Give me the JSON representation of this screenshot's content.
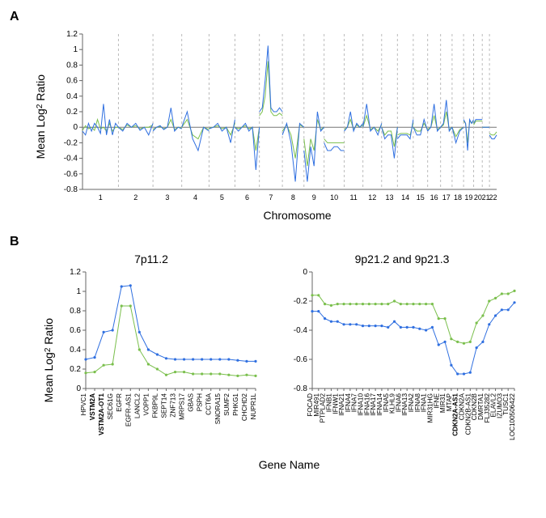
{
  "labels": {
    "panel_a": "A",
    "panel_b": "B",
    "ylabel_a": "Mean Log₂ Ratio",
    "xlabel_a": "Chromosome",
    "ylabel_b": "Mean Log₂ Ratio",
    "xlabel_b": "Gene Name",
    "title_b1": "7p11.2",
    "title_b2": "9p21.2 and 9p21.3"
  },
  "chart_data": [
    {
      "id": "panelA",
      "type": "line",
      "title": "",
      "xlabel": "Chromosome",
      "ylabel": "Mean Log2 Ratio",
      "ylim": [
        -0.8,
        1.2
      ],
      "yticks": [
        -0.8,
        -0.6,
        -0.4,
        -0.2,
        0,
        0.2,
        0.4,
        0.6,
        0.8,
        1,
        1.2
      ],
      "chrom_ticks": [
        1,
        2,
        3,
        4,
        5,
        6,
        7,
        8,
        9,
        10,
        11,
        12,
        13,
        14,
        15,
        16,
        17,
        18,
        19,
        20,
        21,
        22
      ],
      "series_blue_segments": [
        {
          "chrom": 1,
          "y": [
            -0.05,
            -0.1,
            0.05,
            -0.05,
            0.05,
            0.0,
            -0.08,
            0.3,
            -0.1,
            0.1,
            -0.1,
            0.05,
            0.0
          ]
        },
        {
          "chrom": 2,
          "y": [
            0.0,
            -0.05,
            0.05,
            0.0,
            0.05,
            -0.04,
            0.0,
            -0.1,
            0.05
          ]
        },
        {
          "chrom": 3,
          "y": [
            -0.05,
            0.0,
            0.02,
            -0.03,
            0.0,
            0.25,
            -0.05,
            0.0,
            -0.02
          ]
        },
        {
          "chrom": 4,
          "y": [
            0.0,
            0.2,
            -0.15,
            -0.3,
            0.0,
            -0.05
          ]
        },
        {
          "chrom": 5,
          "y": [
            -0.02,
            0.0,
            0.05,
            -0.05,
            0.0,
            -0.2,
            0.1
          ]
        },
        {
          "chrom": 6,
          "y": [
            0.0,
            -0.05,
            0.0,
            0.05,
            -0.05,
            0.0,
            -0.55,
            0.0
          ]
        },
        {
          "chrom": 7,
          "y": [
            0.2,
            0.25,
            0.6,
            1.05,
            0.25,
            0.2,
            0.2,
            0.25,
            0.2
          ]
        },
        {
          "chrom": 8,
          "y": [
            -0.1,
            0.05,
            -0.2,
            -0.7,
            0.05,
            0.0
          ]
        },
        {
          "chrom": 9,
          "y": [
            -0.3,
            -0.7,
            -0.25,
            -0.5,
            0.2,
            -0.05,
            0.0
          ]
        },
        {
          "chrom": 10,
          "y": [
            -0.2,
            -0.3,
            -0.3,
            -0.25,
            -0.25,
            -0.3,
            -0.3
          ]
        },
        {
          "chrom": 11,
          "y": [
            -0.05,
            0.0,
            0.2,
            -0.05,
            0.05,
            0.0,
            0.05
          ]
        },
        {
          "chrom": 12,
          "y": [
            0.0,
            0.3,
            -0.05,
            0.0,
            -0.1,
            0.05
          ]
        },
        {
          "chrom": 13,
          "y": [
            0.0,
            -0.15,
            -0.1,
            -0.1,
            -0.4,
            0.0
          ]
        },
        {
          "chrom": 14,
          "y": [
            -0.15,
            -0.1,
            -0.1,
            -0.1,
            -0.15,
            0.1
          ]
        },
        {
          "chrom": 15,
          "y": [
            0.0,
            -0.1,
            -0.1,
            0.1,
            -0.05
          ]
        },
        {
          "chrom": 16,
          "y": [
            -0.05,
            0.0,
            0.3,
            -0.05,
            0.0
          ]
        },
        {
          "chrom": 17,
          "y": [
            0.0,
            0.05,
            0.35,
            -0.05,
            0.0
          ]
        },
        {
          "chrom": 18,
          "y": [
            0.0,
            -0.2,
            -0.05,
            0.0
          ]
        },
        {
          "chrom": 19,
          "y": [
            0.1,
            0.05,
            -0.3,
            0.1,
            0.05,
            0.1
          ]
        },
        {
          "chrom": 20,
          "y": [
            0.05,
            0.1,
            0.1,
            0.1,
            0.1
          ]
        },
        {
          "chrom": 21,
          "y": [
            0.0,
            0.0,
            0.0
          ]
        },
        {
          "chrom": 22,
          "y": [
            -0.1,
            -0.15,
            -0.15,
            -0.1
          ]
        }
      ],
      "series_green_segments": [
        {
          "chrom": 1,
          "y": [
            -0.04,
            0.02,
            -0.02,
            0.0,
            -0.04,
            0.1,
            -0.02,
            0.0,
            -0.05,
            0.05,
            -0.05,
            0.0,
            0.0
          ]
        },
        {
          "chrom": 2,
          "y": [
            0.0,
            -0.03,
            0.03,
            0.0,
            0.02,
            -0.02,
            0.0,
            0.0,
            0.03
          ]
        },
        {
          "chrom": 3,
          "y": [
            -0.03,
            0.0,
            0.01,
            -0.02,
            0.0,
            0.1,
            -0.03,
            0.0,
            -0.01
          ]
        },
        {
          "chrom": 4,
          "y": [
            0.0,
            0.1,
            -0.1,
            -0.15,
            0.0,
            -0.03
          ]
        },
        {
          "chrom": 5,
          "y": [
            -0.01,
            0.0,
            0.02,
            -0.02,
            0.0,
            -0.1,
            0.05
          ]
        },
        {
          "chrom": 6,
          "y": [
            0.0,
            -0.02,
            0.0,
            0.02,
            -0.02,
            0.0,
            -0.3,
            0.0
          ]
        },
        {
          "chrom": 7,
          "y": [
            0.15,
            0.2,
            0.4,
            0.85,
            0.2,
            0.15,
            0.15,
            0.18,
            0.15
          ]
        },
        {
          "chrom": 8,
          "y": [
            -0.05,
            0.03,
            -0.1,
            -0.4,
            0.03,
            0.0
          ]
        },
        {
          "chrom": 9,
          "y": [
            -0.15,
            -0.5,
            -0.15,
            -0.3,
            0.1,
            -0.03,
            0.0
          ]
        },
        {
          "chrom": 10,
          "y": [
            -0.15,
            -0.2,
            -0.2,
            -0.2,
            -0.2,
            -0.2,
            -0.2
          ]
        },
        {
          "chrom": 11,
          "y": [
            -0.03,
            0.0,
            0.1,
            -0.03,
            0.03,
            0.0,
            0.03
          ]
        },
        {
          "chrom": 12,
          "y": [
            0.0,
            0.15,
            -0.03,
            0.0,
            -0.05,
            0.03
          ]
        },
        {
          "chrom": 13,
          "y": [
            0.0,
            -0.1,
            -0.05,
            -0.05,
            -0.25,
            0.0
          ]
        },
        {
          "chrom": 14,
          "y": [
            -0.1,
            -0.08,
            -0.08,
            -0.08,
            -0.1,
            0.05
          ]
        },
        {
          "chrom": 15,
          "y": [
            0.0,
            -0.05,
            -0.05,
            0.05,
            -0.03
          ]
        },
        {
          "chrom": 16,
          "y": [
            -0.03,
            0.0,
            0.15,
            -0.03,
            0.0
          ]
        },
        {
          "chrom": 17,
          "y": [
            0.0,
            0.03,
            0.2,
            -0.03,
            0.0
          ]
        },
        {
          "chrom": 18,
          "y": [
            0.0,
            -0.12,
            -0.03,
            0.0
          ]
        },
        {
          "chrom": 19,
          "y": [
            0.08,
            0.05,
            -0.2,
            0.08,
            0.05,
            0.08
          ]
        },
        {
          "chrom": 20,
          "y": [
            0.03,
            0.08,
            0.08,
            0.08,
            0.08
          ]
        },
        {
          "chrom": 21,
          "y": [
            0.0,
            0.0,
            0.0
          ]
        },
        {
          "chrom": 22,
          "y": [
            -0.08,
            -0.1,
            -0.1,
            -0.06
          ]
        }
      ]
    },
    {
      "id": "panelB1",
      "type": "line",
      "title": "7p11.2",
      "xlabel": "Gene Name",
      "ylabel": "Mean Log2 Ratio",
      "ylim": [
        0,
        1.2
      ],
      "yticks": [
        0,
        0.2,
        0.4,
        0.6,
        0.8,
        1,
        1.2
      ],
      "categories": [
        "HPVC1",
        "VSTM2A",
        "VSTM2A-OT1",
        "SEC61G",
        "EGFR",
        "EGFR-AS1",
        "LANCL2",
        "VOPP1",
        "FKBP9L",
        "SEPT14",
        "ZNF713",
        "MRPS17",
        "GBAS",
        "PSPH",
        "CCT6A",
        "SNORA15",
        "SUMF2",
        "PHKG1",
        "CHCHD2",
        "NUPR1L"
      ],
      "bold": [
        "VSTM2A",
        "VSTM2A-OT1"
      ],
      "series": [
        {
          "name": "blue",
          "values": [
            0.3,
            0.32,
            0.58,
            0.6,
            1.05,
            1.06,
            0.58,
            0.4,
            0.35,
            0.31,
            0.3,
            0.3,
            0.3,
            0.3,
            0.3,
            0.3,
            0.3,
            0.29,
            0.28,
            0.28
          ]
        },
        {
          "name": "green",
          "values": [
            0.16,
            0.17,
            0.24,
            0.25,
            0.85,
            0.85,
            0.4,
            0.25,
            0.2,
            0.14,
            0.17,
            0.17,
            0.15,
            0.15,
            0.15,
            0.15,
            0.14,
            0.13,
            0.14,
            0.13
          ]
        }
      ]
    },
    {
      "id": "panelB2",
      "type": "line",
      "title": "9p21.2 and 9p21.3",
      "xlabel": "Gene Name",
      "ylabel": "Mean Log2 Ratio",
      "ylim": [
        -0.8,
        0
      ],
      "yticks": [
        -0.8,
        -0.6,
        -0.4,
        -0.2,
        0
      ],
      "categories": [
        "FOCAD",
        "MIR491",
        "PTPLAD2",
        "IFNB1",
        "IFNW1",
        "IFNA21",
        "IFNA4",
        "IFNA7",
        "IFNA10",
        "IFNA16",
        "IFNA17",
        "IFNA14",
        "IFNA5",
        "KLHL9",
        "IFNA6",
        "IFNA13",
        "IFNA2",
        "IFNA8",
        "IFNA1",
        "MIR31HG",
        "IFNE",
        "MIR31",
        "MTAP",
        "CDKN2A-AS1",
        "CDKN2A",
        "CDKN2B-AS1",
        "CDKN2B",
        "DMRTA1",
        "FLJ35282",
        "ELAVL2",
        "IZUMO3",
        "TUSC1",
        "LOC100506422"
      ],
      "bold": [
        "CDKN2A-AS1"
      ],
      "series": [
        {
          "name": "blue",
          "values": [
            -0.27,
            -0.27,
            -0.32,
            -0.34,
            -0.34,
            -0.36,
            -0.36,
            -0.36,
            -0.37,
            -0.37,
            -0.37,
            -0.37,
            -0.38,
            -0.34,
            -0.38,
            -0.38,
            -0.38,
            -0.39,
            -0.4,
            -0.38,
            -0.5,
            -0.48,
            -0.64,
            -0.7,
            -0.7,
            -0.69,
            -0.52,
            -0.48,
            -0.36,
            -0.3,
            -0.26,
            -0.26,
            -0.21
          ]
        },
        {
          "name": "green",
          "values": [
            -0.16,
            -0.16,
            -0.22,
            -0.23,
            -0.22,
            -0.22,
            -0.22,
            -0.22,
            -0.22,
            -0.22,
            -0.22,
            -0.22,
            -0.22,
            -0.2,
            -0.22,
            -0.22,
            -0.22,
            -0.22,
            -0.22,
            -0.22,
            -0.32,
            -0.32,
            -0.46,
            -0.48,
            -0.49,
            -0.48,
            -0.35,
            -0.3,
            -0.2,
            -0.18,
            -0.15,
            -0.15,
            -0.13
          ]
        }
      ]
    }
  ]
}
